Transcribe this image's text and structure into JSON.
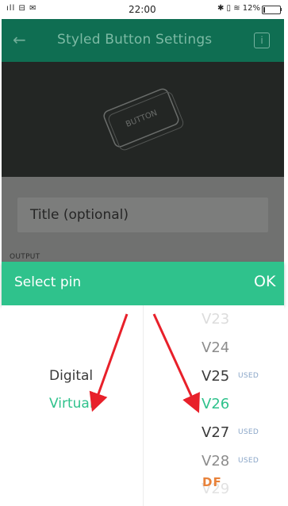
{
  "status_bar": {
    "left": "ıll ⊟ ✉",
    "time": "22:00",
    "right": "✱ ▯ ≋ 12%",
    "battery_percent": 12
  },
  "header": {
    "title": "Styled Button Settings",
    "info_label": "i"
  },
  "preview": {
    "button_label": "BUTTON"
  },
  "form": {
    "title_placeholder": "Title (optional)",
    "output_label": "OUTPUT"
  },
  "select_bar": {
    "label": "Select pin",
    "ok": "OK"
  },
  "picker": {
    "types": [
      {
        "label": "Digital",
        "selected": false
      },
      {
        "label": "Virtual",
        "selected": true
      }
    ],
    "pins": [
      {
        "label": "V23",
        "used": false,
        "used_label": ""
      },
      {
        "label": "V24",
        "used": false,
        "used_label": ""
      },
      {
        "label": "V25",
        "used": true,
        "used_label": "USED"
      },
      {
        "label": "V26",
        "used": false,
        "selected": true,
        "used_label": ""
      },
      {
        "label": "V27",
        "used": true,
        "used_label": "USED"
      },
      {
        "label": "V28",
        "used": true,
        "used_label": "USED"
      },
      {
        "label": "V29",
        "used": false,
        "used_label": ""
      }
    ]
  },
  "watermark": "DF",
  "colors": {
    "header": "#0f6e52",
    "accent": "#2fc28c",
    "arrow": "#e8202a"
  }
}
